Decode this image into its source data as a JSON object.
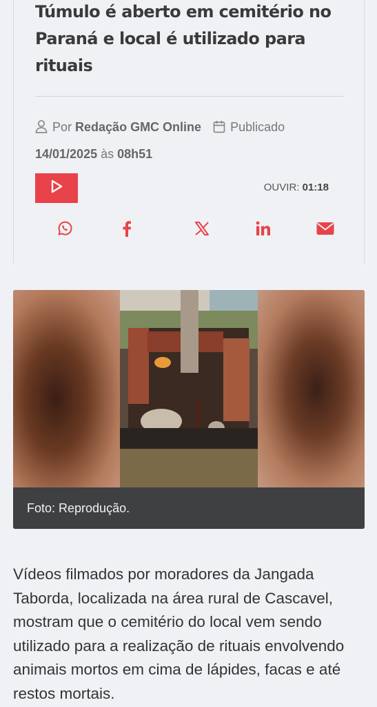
{
  "article": {
    "title": "Túmulo é aberto em cemitério no Paraná e local é utilizado para rituais",
    "by_prefix": "Por",
    "author": "Redação GMC Online",
    "published_label": "Publicado",
    "date": "14/01/2025",
    "at": "às",
    "time": "08h51"
  },
  "audio": {
    "listen_label": "OUVIR:",
    "duration": "01:18"
  },
  "share": {
    "icons": [
      "whatsapp-icon",
      "facebook-icon",
      "x-twitter-icon",
      "linkedin-icon",
      "email-icon"
    ],
    "accent": "#e8424a"
  },
  "photo": {
    "caption": "Foto: Reprodução."
  },
  "body": {
    "paragraph": "Vídeos filmados por moradores da Jangada Taborda, localizada na área rural de Cascavel, mostram que o cemitério do local vem sendo utilizado para a realização de rituais envolvendo animais mortos em cima de lápides, facas e até restos mortais."
  }
}
